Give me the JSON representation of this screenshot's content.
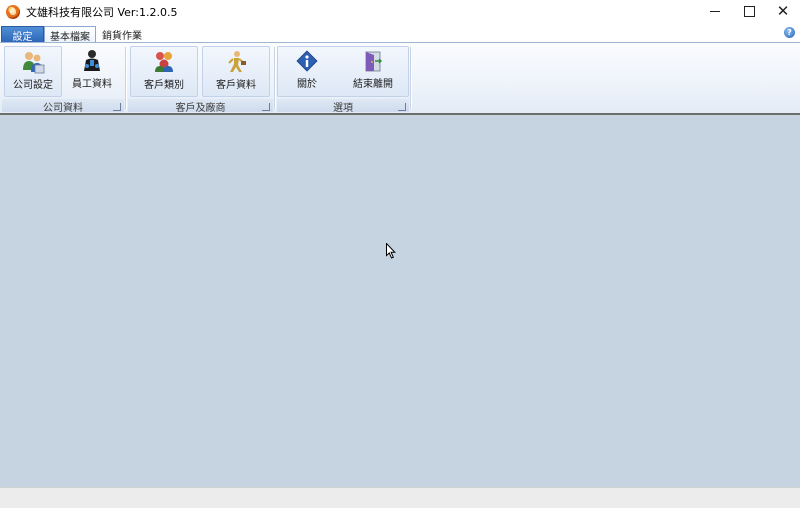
{
  "window": {
    "title": "文雄科技有限公司 Ver:1.2.0.5"
  },
  "tabs": [
    {
      "label": "設定"
    },
    {
      "label": "基本檔案"
    },
    {
      "label": "銷貨作業"
    }
  ],
  "ribbon": {
    "groups": [
      {
        "label": "公司資料",
        "buttons": [
          {
            "label": "公司設定",
            "icon": "company-settings-icon"
          },
          {
            "label": "員工資料",
            "icon": "employee-icon"
          }
        ]
      },
      {
        "label": "客戶及廠商",
        "buttons": [
          {
            "label": "客戶類別",
            "icon": "customer-category-icon"
          },
          {
            "label": "客戶資料",
            "icon": "customer-data-icon"
          }
        ]
      },
      {
        "label": "選項",
        "buttons": [
          {
            "label": "關於",
            "icon": "info-icon"
          },
          {
            "label": "結束離開",
            "icon": "exit-door-icon"
          }
        ]
      }
    ]
  },
  "colors": {
    "workspace": "#c6d3e1",
    "accent": "#2a62b4"
  }
}
